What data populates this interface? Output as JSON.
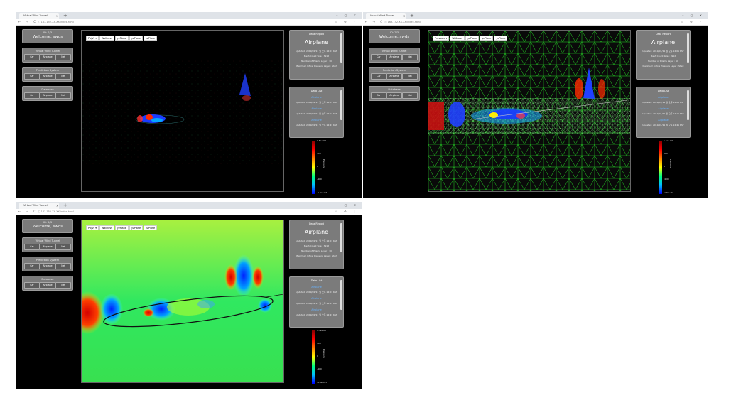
{
  "browser": {
    "tab_title": "Virtual Wind Tunnel",
    "tab_close": "×",
    "new_tab": "+",
    "window_controls": "– ▢ ✕",
    "nav_buttons": "← → C",
    "url": "ⓘ 163.152.XX.XX/index.html",
    "ext_icons": "☆ ⚙ ⋮"
  },
  "sidebar": {
    "user_id": "ID: 2/3",
    "welcome": "Welcome, swds",
    "groups": [
      {
        "title": "Virtual Wind Tunnel",
        "buttons": [
          "Car",
          "Airplane",
          "Net"
        ]
      },
      {
        "title": "Prediction System",
        "buttons": [
          "Car",
          "Airplane",
          "Net"
        ]
      },
      {
        "title": "Database",
        "buttons": [
          "Car",
          "Airplane",
          "Net"
        ]
      }
    ]
  },
  "field_selectors": {
    "top_left": [
      "Pa/Vs ▾",
      "Wallness",
      "yzPlane",
      "yzPlane",
      "yzPlane"
    ],
    "top_right": [
      "Pressure ▾",
      "Wallness",
      "yzPlane",
      "yzPlane",
      "yzPlane"
    ],
    "bottom_left": [
      "Pa/Vs ▾",
      "Wallness",
      "yzPlane",
      "yzPlane",
      "yzPlane"
    ]
  },
  "data_report": {
    "title": "Data Report",
    "subject": "Airplane",
    "lines": [
      "Updated: 2019/01/11 월 오후 12:01 KST",
      "Mesh Count Size : 3912",
      "Number of Prisms Layer : 10",
      "Maximum Inflow Pressure Layer : Start"
    ]
  },
  "data_list": {
    "title": "Data List",
    "items": [
      {
        "link": "Airplane",
        "date": "Updated: 2019/01/11 월 오후 12:01 KST"
      },
      {
        "link": "Airplane",
        "date": "Updated: 2019/01/11 월 오후 12:11 KST"
      },
      {
        "link": "Airplane",
        "date": "Updated: 2019/01/11 월 오후 12:41 KST"
      }
    ]
  },
  "colorbar": {
    "max": "1.5e+03",
    "mid_hi": "400",
    "mid": "0",
    "mid_lo": "-400",
    "min": "-1.6e+03",
    "label": "Pressure"
  },
  "colors": {
    "panel": "#7b7b7b",
    "link": "#69b4ff",
    "mesh": "#2aff2a"
  }
}
